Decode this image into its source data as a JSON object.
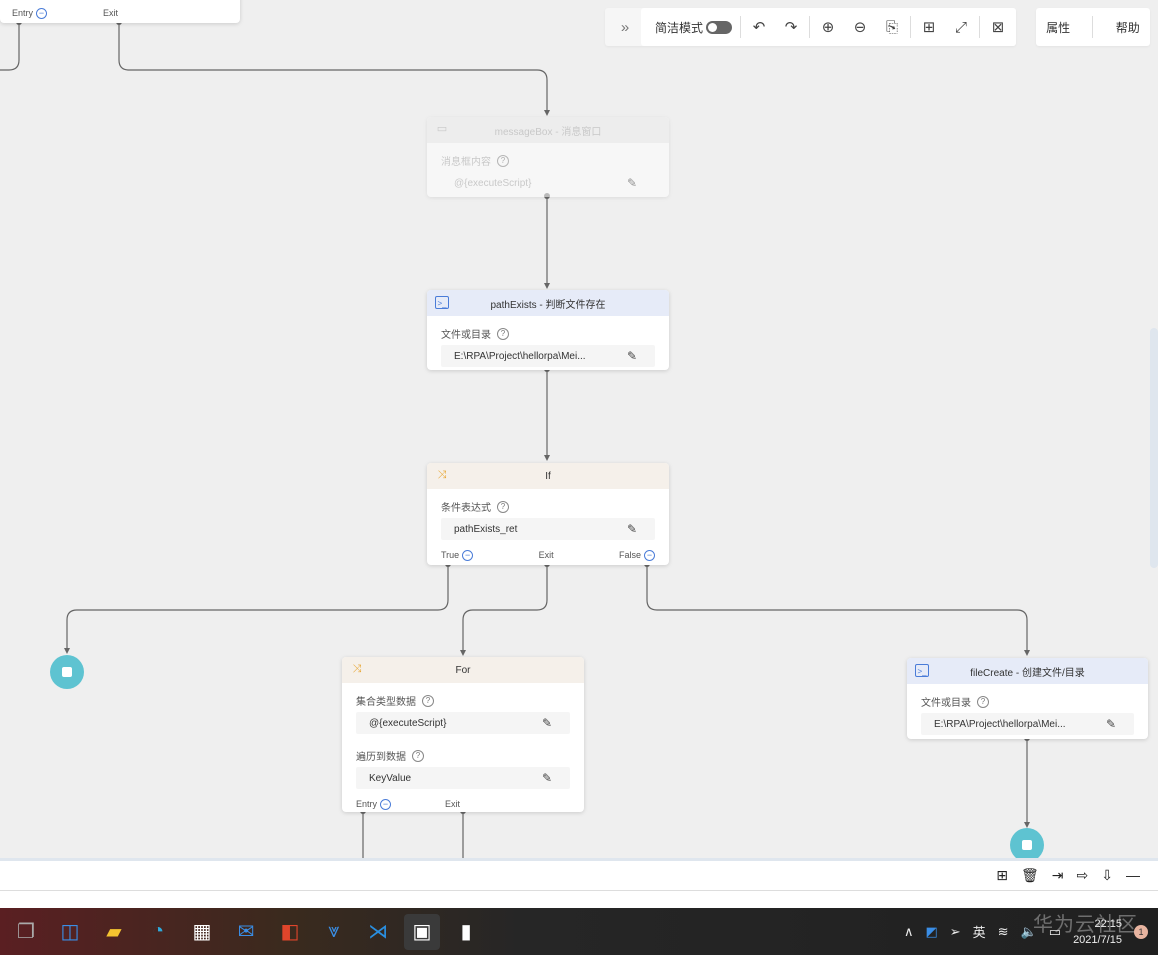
{
  "toolbar": {
    "expand_icon": "double-chevron-right",
    "simple_mode_label": "简洁模式",
    "simple_mode_on": false,
    "icons": [
      "undo",
      "redo",
      "zoom-in",
      "zoom-out",
      "fit-view",
      "layout",
      "fullscreen",
      "close-canvas"
    ]
  },
  "side_tabs": {
    "properties": "属性",
    "help": "帮助"
  },
  "top_node": {
    "entry": "Entry",
    "exit": "Exit"
  },
  "nodes": {
    "messagebox": {
      "title": "messageBox - 消息窗口",
      "field_label": "消息框内容",
      "field_value": "@{executeScript}",
      "disabled": true
    },
    "pathexists": {
      "title": "pathExists - 判断文件存在",
      "field_label": "文件或目录",
      "field_value": "E:\\RPA\\Project\\hellorpa\\Mei..."
    },
    "if": {
      "title": "If",
      "field_label": "条件表达式",
      "field_value": "pathExists_ret",
      "true": "True",
      "exit": "Exit",
      "false": "False"
    },
    "for": {
      "title": "For",
      "field1_label": "集合类型数据",
      "field1_value": "@{executeScript}",
      "field2_label": "遍历到数据",
      "field2_value": "KeyValue",
      "entry": "Entry",
      "exit": "Exit"
    },
    "filecreate": {
      "title": "fileCreate - 创建文件/目录",
      "field_label": "文件或目录",
      "field_value": "E:\\RPA\\Project\\hellorpa\\Mei..."
    }
  },
  "colors": {
    "accent": "#4a7cd8",
    "end_node": "#5ec3d1",
    "canvas": "#efefef"
  },
  "panel_tools": [
    "add",
    "delete",
    "import",
    "export",
    "filter-export",
    "minimize"
  ],
  "taskbar": {
    "apps": [
      "task-view",
      "widgets",
      "file-explorer",
      "edge",
      "store",
      "mail",
      "office",
      "app-down",
      "vscode",
      "rpa-app",
      "terminal"
    ],
    "ime": "英",
    "time": "22:15",
    "date": "2021/7/15",
    "notifications": "1",
    "watermark": "华为云社区"
  }
}
